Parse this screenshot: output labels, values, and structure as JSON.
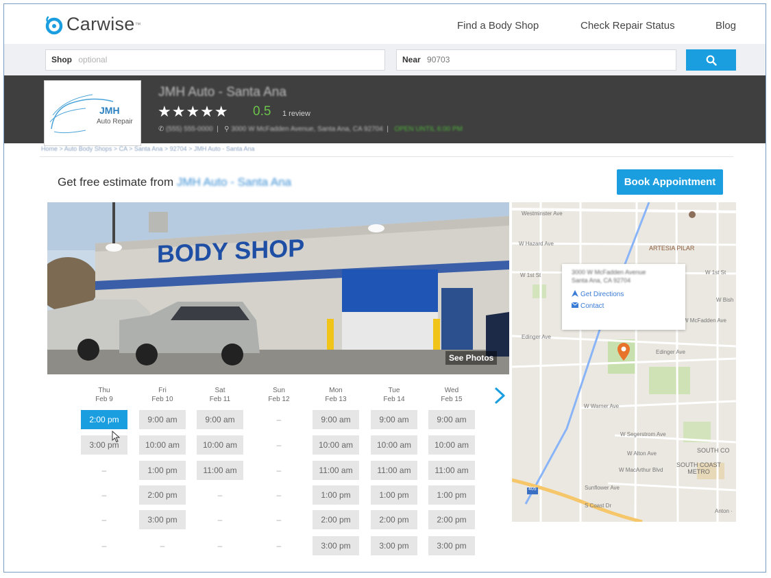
{
  "header": {
    "logo_text": "Carwise",
    "logo_tm": "™",
    "nav": [
      "Find a Body Shop",
      "Check Repair Status",
      "Blog"
    ]
  },
  "search": {
    "shop_label": "Shop",
    "shop_placeholder": "optional",
    "near_label": "Near",
    "near_value": "90703",
    "search_icon": "search-icon"
  },
  "shop": {
    "logo_line1": "JMH",
    "logo_line2": "Auto Repair",
    "name": "JMH Auto - Santa Ana",
    "stars": "★★★★★",
    "rating": "0.5",
    "reviews": "1 review",
    "phone": "(555) 555-0000",
    "address": "3000 W McFadden Avenue, Santa Ana, CA 92704",
    "hours": "OPEN UNTIL 6:00 PM"
  },
  "breadcrumb": "Home > Auto Body Shops > CA > Santa Ana > 92704 > JMH Auto - Santa Ana",
  "estimate": {
    "label": "Get free estimate from",
    "shop": "JMH Auto - Santa Ana"
  },
  "book_button": "Book Appointment",
  "photo": {
    "sign_text": "BODY SHOP",
    "see_photos": "See Photos"
  },
  "schedule": {
    "days": [
      {
        "dow": "Thu",
        "date": "Feb 9",
        "slots": [
          "2:00 pm",
          "3:00 pm",
          "–",
          "–",
          "–",
          "–"
        ],
        "selected": 0
      },
      {
        "dow": "Fri",
        "date": "Feb 10",
        "slots": [
          "9:00 am",
          "10:00 am",
          "1:00 pm",
          "2:00 pm",
          "3:00 pm",
          "–"
        ]
      },
      {
        "dow": "Sat",
        "date": "Feb 11",
        "slots": [
          "9:00 am",
          "10:00 am",
          "11:00 am",
          "–",
          "–",
          "–"
        ]
      },
      {
        "dow": "Sun",
        "date": "Feb 12",
        "slots": [
          "–",
          "–",
          "–",
          "–",
          "–",
          "–"
        ]
      },
      {
        "dow": "Mon",
        "date": "Feb 13",
        "slots": [
          "9:00 am",
          "10:00 am",
          "11:00 am",
          "1:00 pm",
          "2:00 pm",
          "3:00 pm"
        ]
      },
      {
        "dow": "Tue",
        "date": "Feb 14",
        "slots": [
          "9:00 am",
          "10:00 am",
          "11:00 am",
          "1:00 pm",
          "2:00 pm",
          "3:00 pm"
        ]
      },
      {
        "dow": "Wed",
        "date": "Feb 15",
        "slots": [
          "9:00 am",
          "10:00 am",
          "11:00 am",
          "1:00 pm",
          "2:00 pm",
          "3:00 pm"
        ]
      }
    ]
  },
  "map": {
    "popup_address_1": "3000 W McFadden Avenue",
    "popup_address_2": "Santa Ana, CA 92704",
    "get_directions": "Get Directions",
    "contact": "Contact",
    "labels": {
      "westminster": "Westminster Ave",
      "hazard": "W Hazard Ave",
      "first_st": "W 1st St",
      "first_st_r": "W 1st St",
      "w_bish": "W Bish",
      "mcfadden": "W McFadden Ave",
      "edinger": "Edinger Ave",
      "edinger_r": "Edinger Ave",
      "warner": "W Warner Ave",
      "segerstrom": "W Segerstrom Ave",
      "alton": "W Alton Ave",
      "macarthur": "W MacArthur Blvd",
      "sunflower": "Sunflower Ave",
      "coast": "S Coast Dr",
      "artesia": "ARTESIA PILAR",
      "south_co": "SOUTH CO",
      "south_coast_metro": "SOUTH COAST\nMETRO",
      "anton": "Anton ·",
      "highway": "405"
    }
  },
  "colors": {
    "accent": "#1a9ee0",
    "banner": "#3f3f3f",
    "rating_green": "#6cc34a",
    "pin": "#e8732a"
  }
}
